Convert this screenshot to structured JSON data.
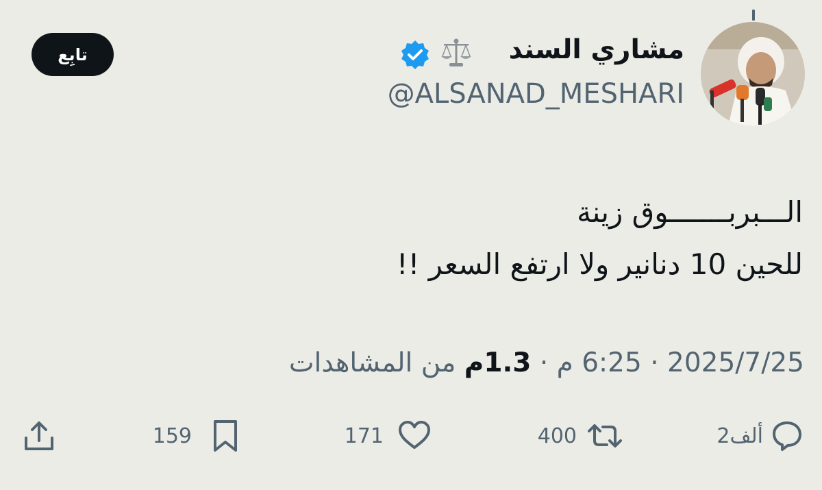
{
  "user": {
    "display_name": "مشاري السند",
    "handle": "@ALSANAD_MESHARI",
    "verified": true,
    "avatar_icon": "profile-photo",
    "name_emoji_icon": "balance-scale-icon"
  },
  "header": {
    "follow_label": "تابِع",
    "more_icon": "more-icon"
  },
  "tweet": {
    "line1": "الـــبربـــــــوق زينة",
    "line2": "للحين 10 دنانير ولا ارتفع السعر !!"
  },
  "meta": {
    "date": "2025/7/25",
    "time": "6:25 م",
    "views_count": "1.3م",
    "views_label": "من المشاهدات",
    "separator": "·"
  },
  "actions": {
    "replies": "2ألف",
    "reposts": "400",
    "likes": "171",
    "bookmarks": "159"
  },
  "colors": {
    "background": "#ecece7",
    "text": "#0f1419",
    "secondary": "#536471",
    "verified": "#1d9bf0",
    "follow_button": "#0f1419"
  }
}
